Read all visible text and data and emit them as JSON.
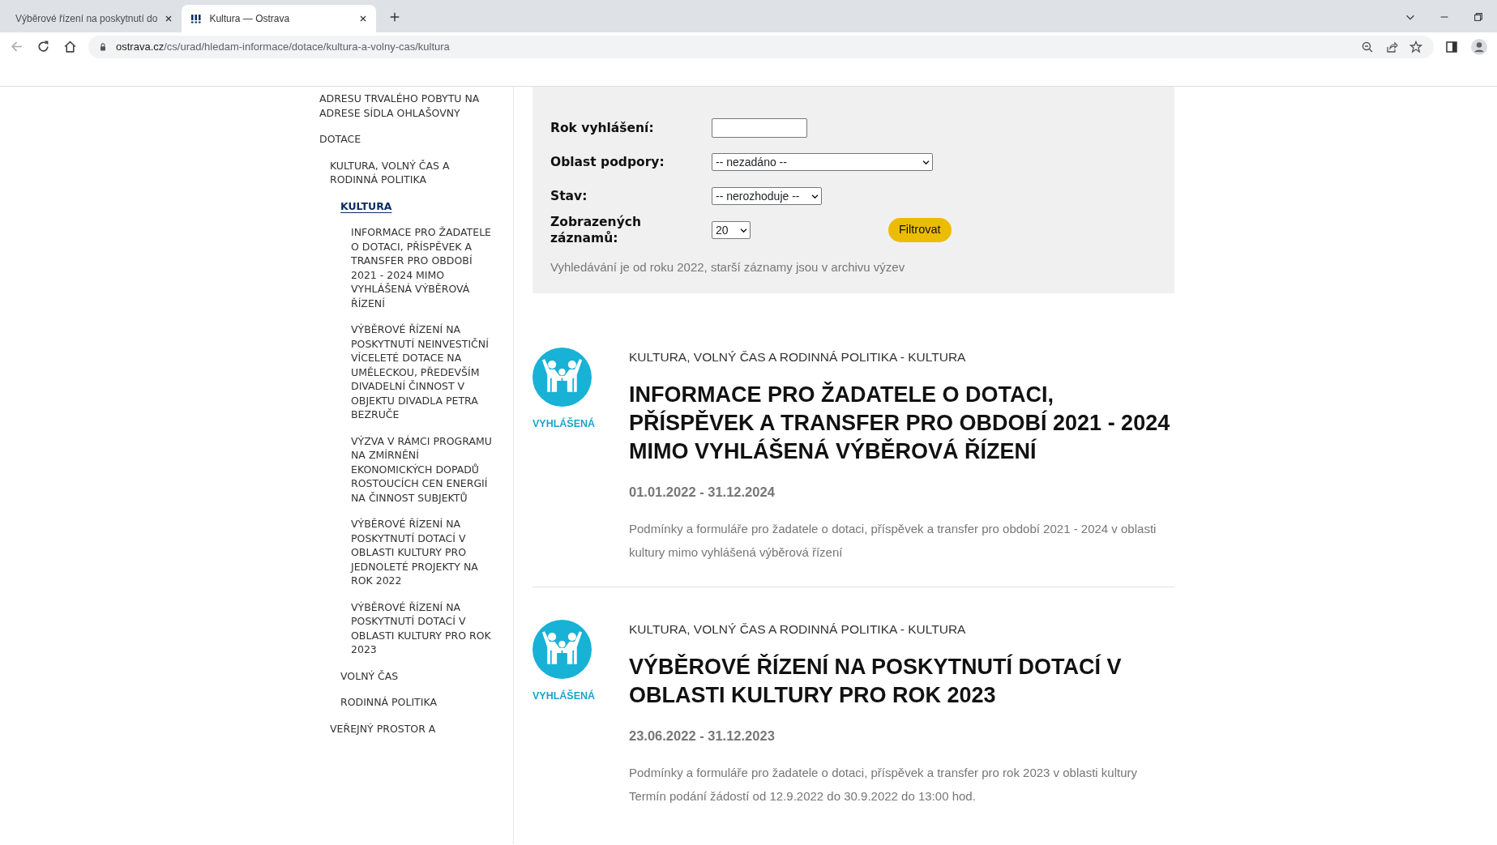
{
  "browser": {
    "tabs": [
      {
        "title": "Výběrové řízení na poskytnutí do",
        "selected": false
      },
      {
        "title": "Kultura — Ostrava",
        "selected": true
      }
    ],
    "url_host": "ostrava.cz",
    "url_path": "/cs/urad/hledam-informace/dotace/kultura-a-volny-cas/kultura"
  },
  "sidebar": {
    "items": [
      {
        "label": "ADRESU TRVALÉHO POBYTU NA ADRESE SÍDLA OHLAŠOVNY",
        "selected": false
      },
      {
        "label": "DOTACE",
        "selected": false,
        "children": [
          {
            "label": "KULTURA, VOLNÝ ČAS A RODINNÁ POLITIKA",
            "selected": false,
            "children": [
              {
                "label": "KULTURA",
                "selected": true,
                "children": [
                  {
                    "label": "INFORMACE PRO ŽADATELE O DOTACI, PŘÍSPĚVEK A TRANSFER PRO OBDOBÍ 2021 - 2024 MIMO VYHLÁŠENÁ VÝBĚROVÁ ŘÍZENÍ",
                    "selected": false
                  },
                  {
                    "label": "VÝBĚROVÉ ŘÍZENÍ NA POSKYTNUTÍ NEINVESTIČNÍ VÍCELETÉ DOTACE NA UMĚLECKOU, PŘEDEVŠÍM DIVADELNÍ ČINNOST V OBJEKTU DIVADLA PETRA BEZRUČE",
                    "selected": false
                  },
                  {
                    "label": "VÝZVA V RÁMCI PROGRAMU NA ZMÍRNĚNÍ EKONOMICKÝCH DOPADŮ ROSTOUCÍCH CEN ENERGIÍ NA ČINNOST SUBJEKTŮ",
                    "selected": false
                  },
                  {
                    "label": "VÝBĚROVÉ ŘÍZENÍ NA POSKYTNUTÍ DOTACÍ V OBLASTI KULTURY PRO JEDNOLETÉ PROJEKTY NA ROK 2022",
                    "selected": false
                  },
                  {
                    "label": "VÝBĚROVÉ ŘÍZENÍ NA POSKYTNUTÍ DOTACÍ V OBLASTI KULTURY PRO ROK 2023",
                    "selected": false
                  }
                ]
              },
              {
                "label": "VOLNÝ ČAS",
                "selected": false
              },
              {
                "label": "RODINNÁ POLITIKA",
                "selected": false
              }
            ]
          },
          {
            "label": "VEŘEJNÝ PROSTOR A",
            "selected": false
          }
        ]
      }
    ]
  },
  "search_form": {
    "fields": [
      {
        "label": "Rok vyhlášení:",
        "kind": "text"
      },
      {
        "label": "Oblast podpory:",
        "kind": "select",
        "value": "-- nezadáno --"
      },
      {
        "label": "Stav:",
        "kind": "select",
        "value": "-- nerozhoduje --"
      },
      {
        "label": "Zobrazených záznamů:",
        "kind": "select",
        "value": "20"
      }
    ],
    "button": "Filtrovat",
    "note": "Vyhledávání je od roku 2022, starší záznamy jsou v archivu výzev"
  },
  "results": [
    {
      "status": "VYHLÁŠENÁ",
      "category": "KULTURA, VOLNÝ ČAS A RODINNÁ POLITIKA - KULTURA",
      "title": "INFORMACE PRO ŽADATELE O DOTACI, PŘÍSPĚVEK A TRANSFER PRO OBDOBÍ 2021 - 2024 MIMO VYHLÁŠENÁ VÝBĚROVÁ ŘÍZENÍ",
      "dates": "01.01.2022 - 31.12.2024",
      "description": "Podmínky a formuláře pro žadatele o dotaci, příspěvek a transfer pro období 2021 - 2024 v oblasti kultury mimo vyhlášená výběrová řízení"
    },
    {
      "status": "VYHLÁŠENÁ",
      "category": "KULTURA, VOLNÝ ČAS A RODINNÁ POLITIKA - KULTURA",
      "title": "VÝBĚROVÉ ŘÍZENÍ NA POSKYTNUTÍ DOTACÍ V OBLASTI KULTURY PRO ROK 2023",
      "dates": "23.06.2022 - 31.12.2023",
      "description": "Podmínky a formuláře pro žadatele o dotaci, příspěvek a transfer pro rok 2023 v oblasti kultury Termín podání žádostí od 12.9.2022 do 30.9.2022 do 13:00 hod."
    }
  ]
}
